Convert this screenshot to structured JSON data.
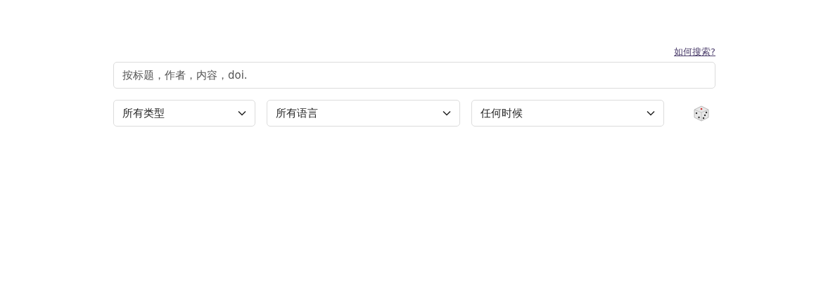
{
  "help_link": "如何搜索?",
  "search": {
    "placeholder": "按标题，作者，内容，doi."
  },
  "filters": [
    {
      "value": "所有类型"
    },
    {
      "value": "所有语言"
    },
    {
      "value": "任何时候"
    }
  ]
}
